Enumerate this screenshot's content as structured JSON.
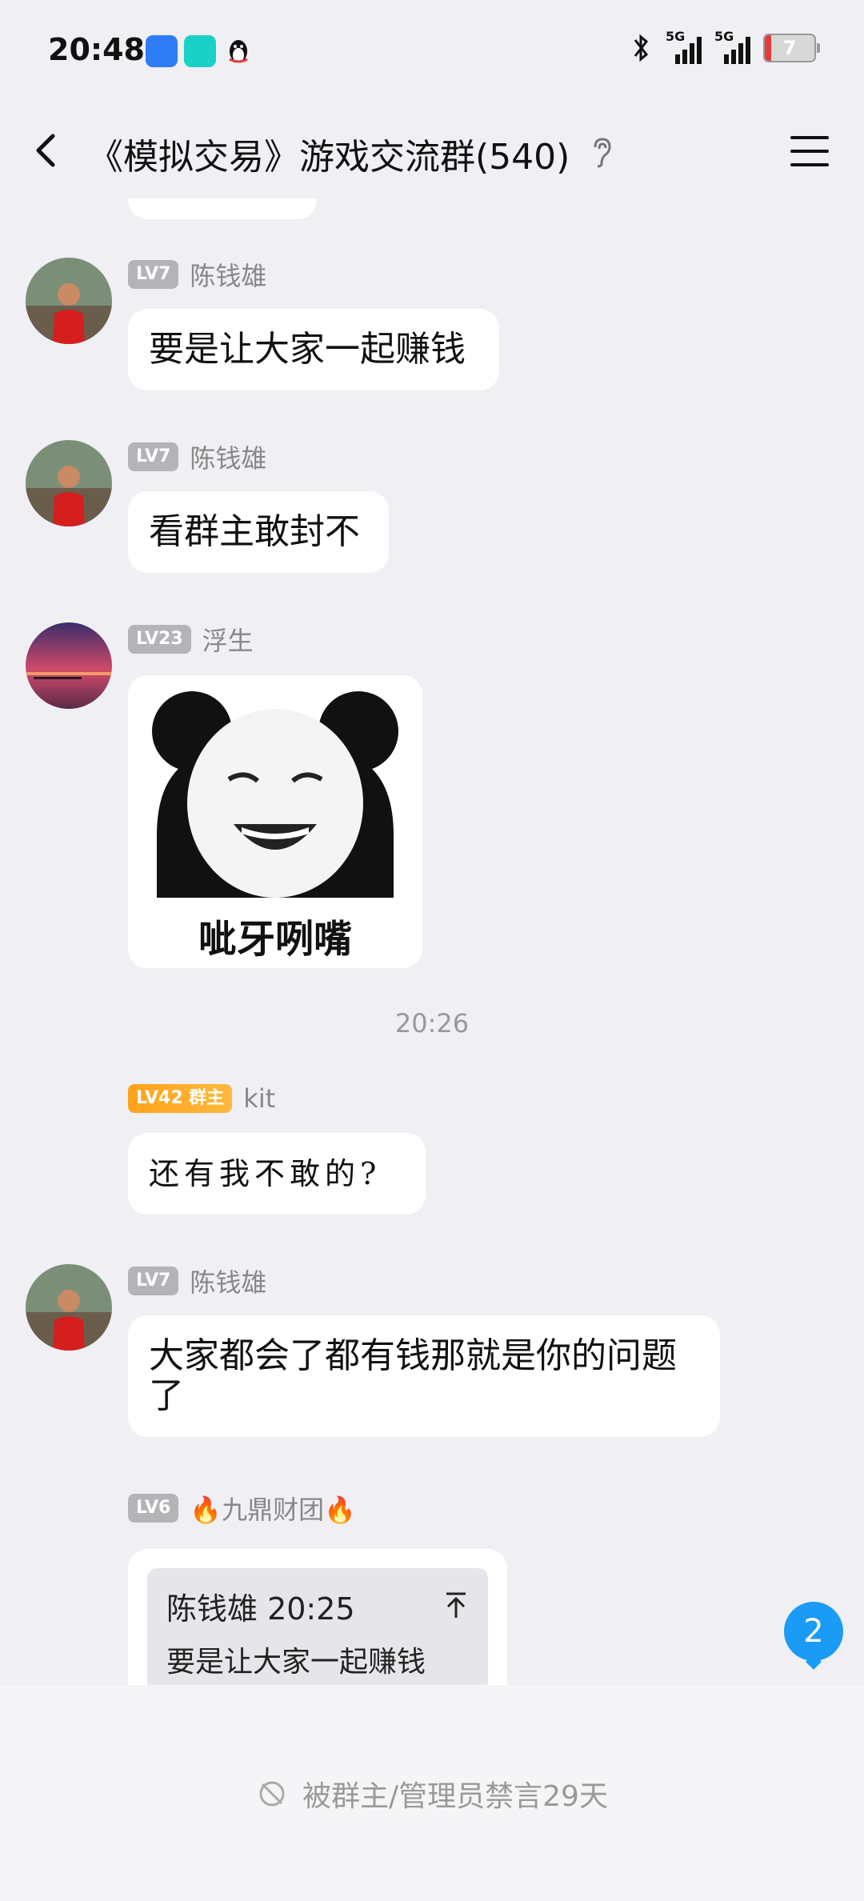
{
  "status_bar": {
    "time": "20:48",
    "battery": "7",
    "signal1": "5G",
    "signal2": "5G"
  },
  "header": {
    "title": "《模拟交易》游戏交流群(540)"
  },
  "messages": [
    {
      "level": "LV7",
      "name": "陈钱雄",
      "text": "要是让大家一起赚钱"
    },
    {
      "level": "LV7",
      "name": "陈钱雄",
      "text": "看群主敢封不"
    },
    {
      "level": "LV23",
      "name": "浮生",
      "sticker_caption": "呲牙咧嘴"
    },
    {
      "level": "LV42 群主",
      "name": "kit",
      "text": "还有我不敢的?"
    },
    {
      "level": "LV7",
      "name": "陈钱雄",
      "text": "大家都会了都有钱那就是你的问题了"
    },
    {
      "level": "LV6",
      "name": "🔥九鼎财团🔥",
      "quote_header": "陈钱雄 20:25",
      "quote_text": "要是让大家一起赚钱"
    }
  ],
  "timestamp": "20:26",
  "unread_count": "2",
  "mute_notice": "被群主/管理员禁言29天",
  "colors": {
    "accent": "#1a9bf5",
    "owner_badge": "#ffa21a",
    "background": "#efeff4"
  }
}
